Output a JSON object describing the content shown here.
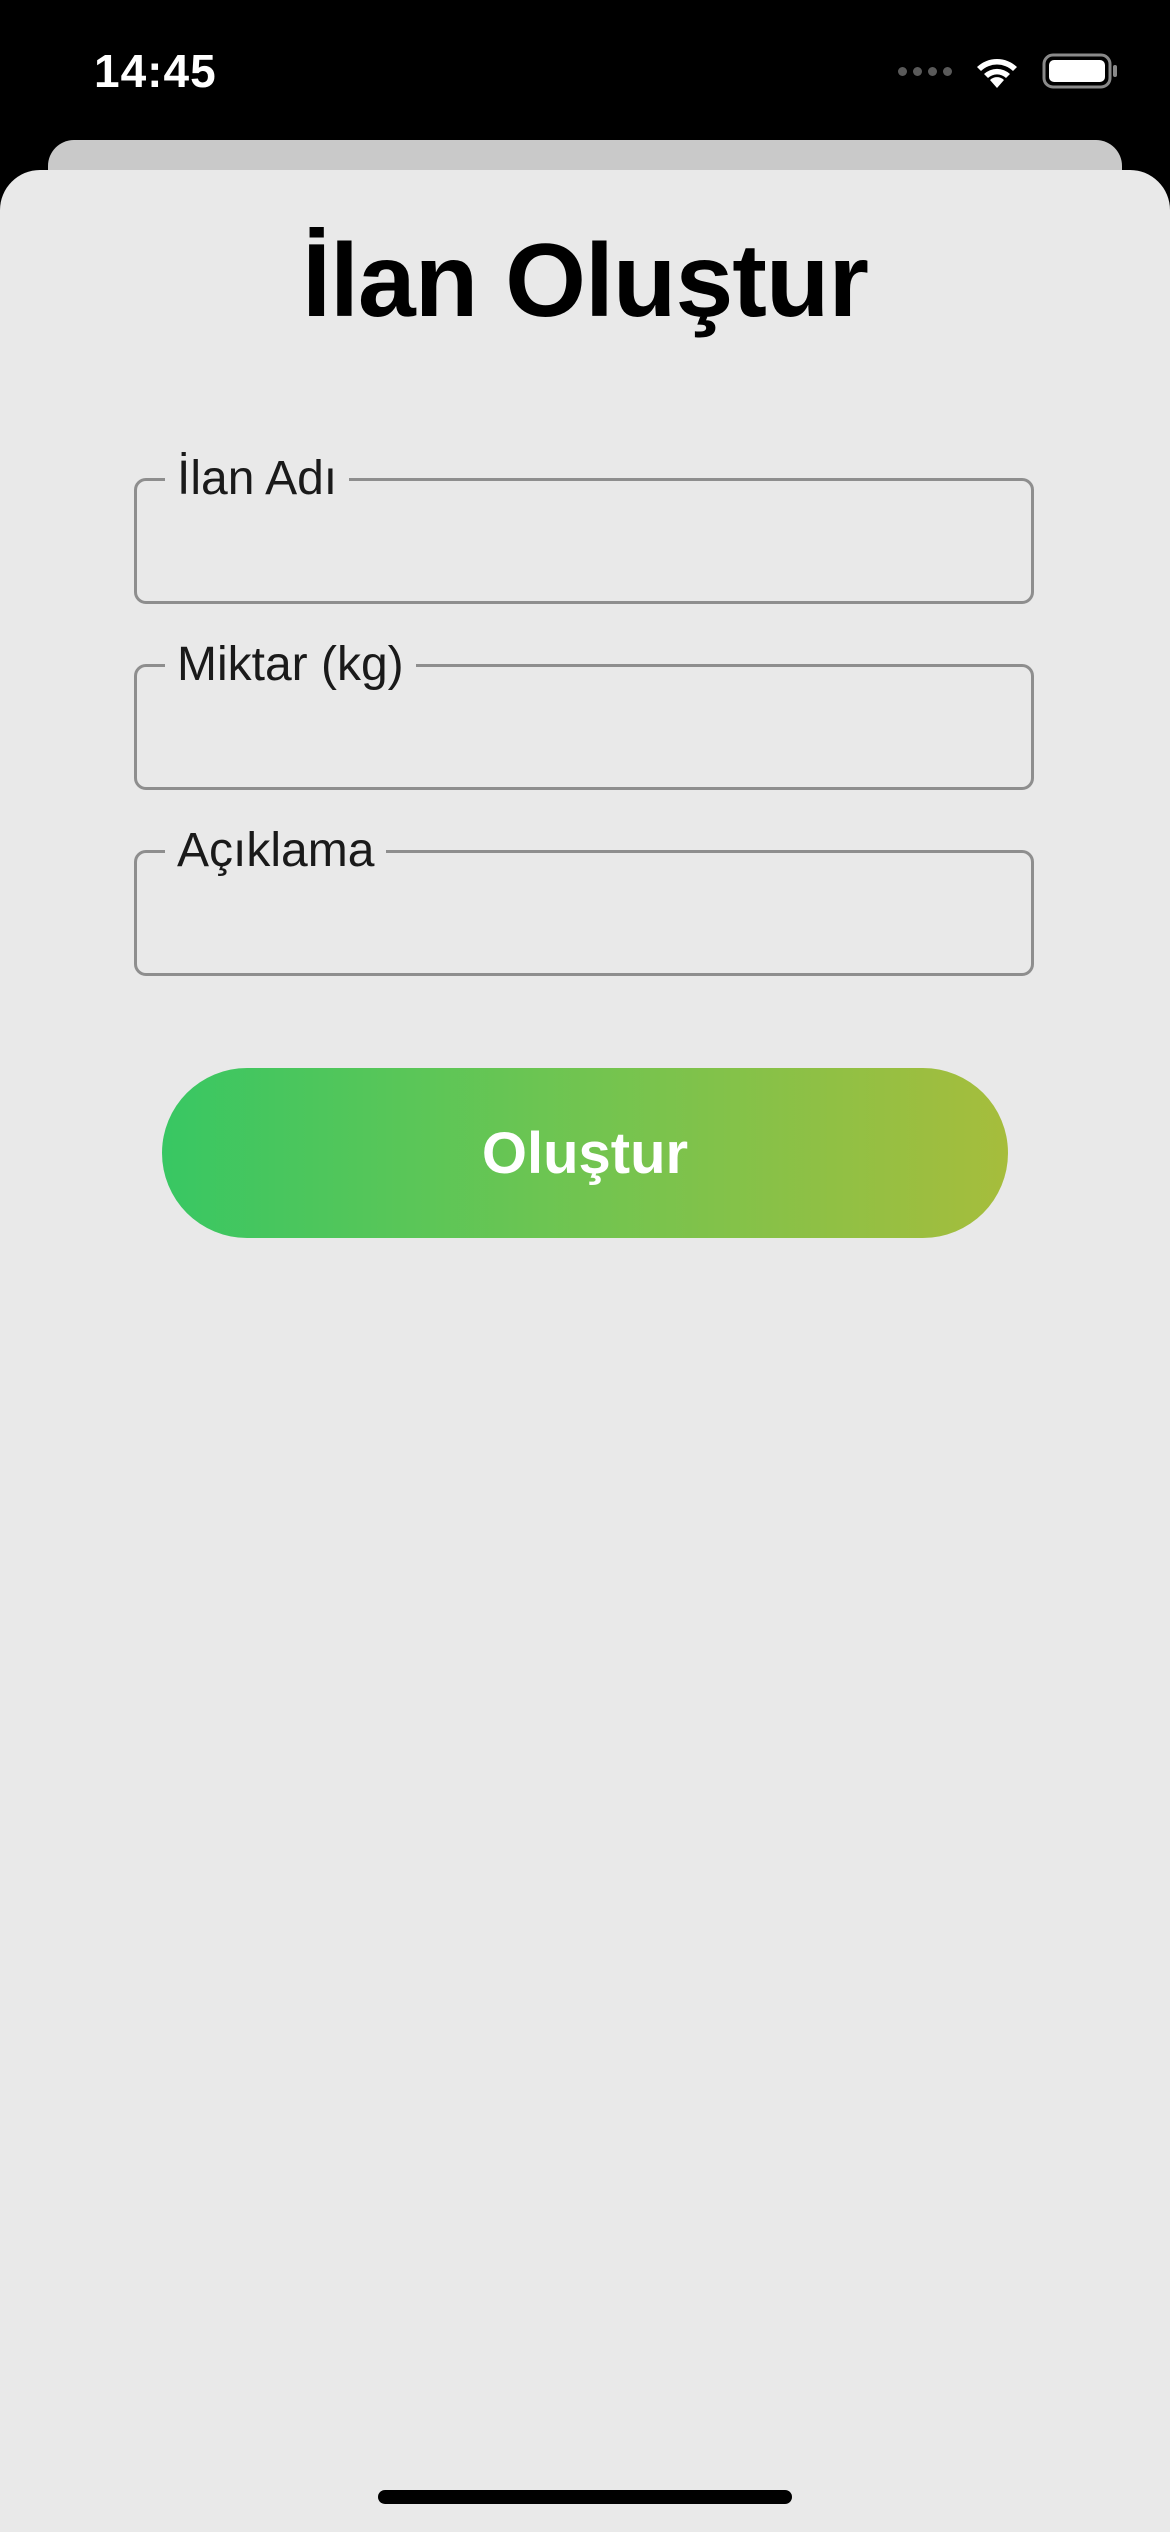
{
  "status_bar": {
    "time": "14:45",
    "icons": [
      "cellular-signal-icon",
      "wifi-icon",
      "battery-icon"
    ]
  },
  "screen": {
    "title": "İlan Oluştur"
  },
  "form": {
    "fields": [
      {
        "label": "İlan Adı",
        "value": "",
        "placeholder": ""
      },
      {
        "label": "Miktar (kg)",
        "value": "",
        "placeholder": ""
      },
      {
        "label": "Açıklama",
        "value": "",
        "placeholder": ""
      }
    ],
    "submit_label": "Oluştur"
  },
  "colors": {
    "sheet_background": "#e9e9e9",
    "button_gradient_start": "#38c763",
    "button_gradient_end": "#a6bd3c",
    "field_border": "#8e8e8e",
    "status_bar_background": "#000000"
  }
}
